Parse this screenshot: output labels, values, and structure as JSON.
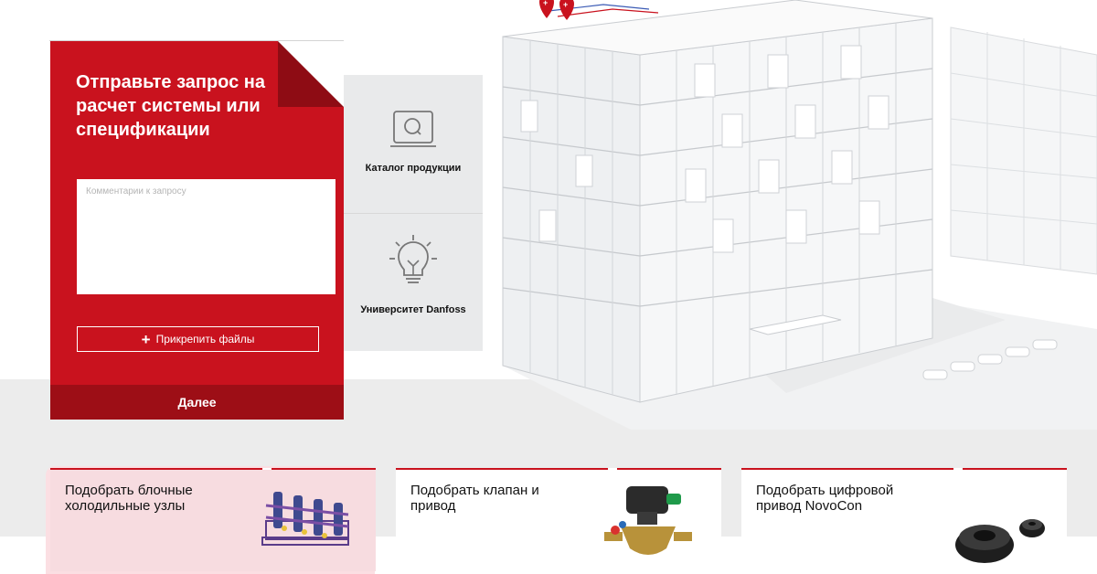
{
  "form": {
    "title": "Отправьте запрос на расчет системы или спецификации",
    "comment_placeholder": "Комментарии к запросу",
    "comment_value": "",
    "attach_label": "Прикрепить файлы",
    "next_label": "Далее"
  },
  "side_menu": [
    {
      "label": "Каталог продукции",
      "icon": "monitor-search-icon"
    },
    {
      "label": "Университет Danfoss",
      "icon": "lightbulb-icon"
    }
  ],
  "cards": [
    {
      "title": "Подобрать блочные холодильные узлы",
      "image": "chiller-block-illustration"
    },
    {
      "title": "Подобрать клапан и привод",
      "image": "valve-actuator-illustration"
    },
    {
      "title": "Подобрать цифровой привод NovoCon",
      "image": "novocon-actuator-illustration"
    }
  ],
  "colors": {
    "brand_red": "#c9121e",
    "dark_red": "#9d0e16",
    "panel_gray": "#e9eaeb",
    "card_highlight": "#f7dce0"
  }
}
